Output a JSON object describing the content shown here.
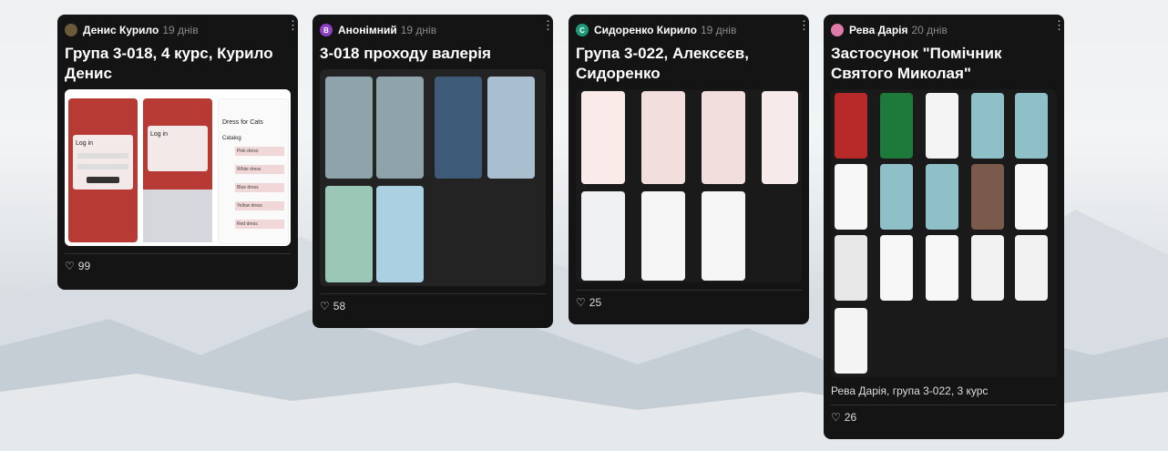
{
  "cards": [
    {
      "author": "Денис Курило",
      "time": "19 днів",
      "avatar_letter": "",
      "avatar_color": "#6b5a3a",
      "title": "Група 3-018, 4 курс, Курило Денис",
      "likes": "99",
      "screens": {
        "login": "Log in",
        "dress_title": "Dress for Cats",
        "catalog": "Catalog",
        "items": [
          "Pink dress",
          "White dress",
          "Blue dress",
          "Yellow dress",
          "Red dress"
        ]
      }
    },
    {
      "author": "Анонімний",
      "time": "19 днів",
      "avatar_letter": "B",
      "avatar_color": "#8e3fc4",
      "title": "3-018 проходу валерія",
      "likes": "58"
    },
    {
      "author": "Сидоренко Кирило",
      "time": "19 днів",
      "avatar_letter": "C",
      "avatar_color": "#1d9a7a",
      "title": "Група 3-022, Алексєєв, Сидоренко",
      "likes": "25"
    },
    {
      "author": "Рева Дарія",
      "time": "20 днів",
      "avatar_letter": "",
      "avatar_color": "#e07aa8",
      "title": "Застосунок \"Помічник Святого Миколая\"",
      "likes": "26",
      "caption": "Рева Дарія, група 3-022, 3 курс"
    }
  ],
  "colors": {
    "card_bg": "#141414",
    "accent_red": "#c7302f",
    "accent_teal": "#7fb2b9"
  },
  "icons": {
    "menu": "vertical-dots-icon",
    "like": "heart-outline-icon"
  }
}
